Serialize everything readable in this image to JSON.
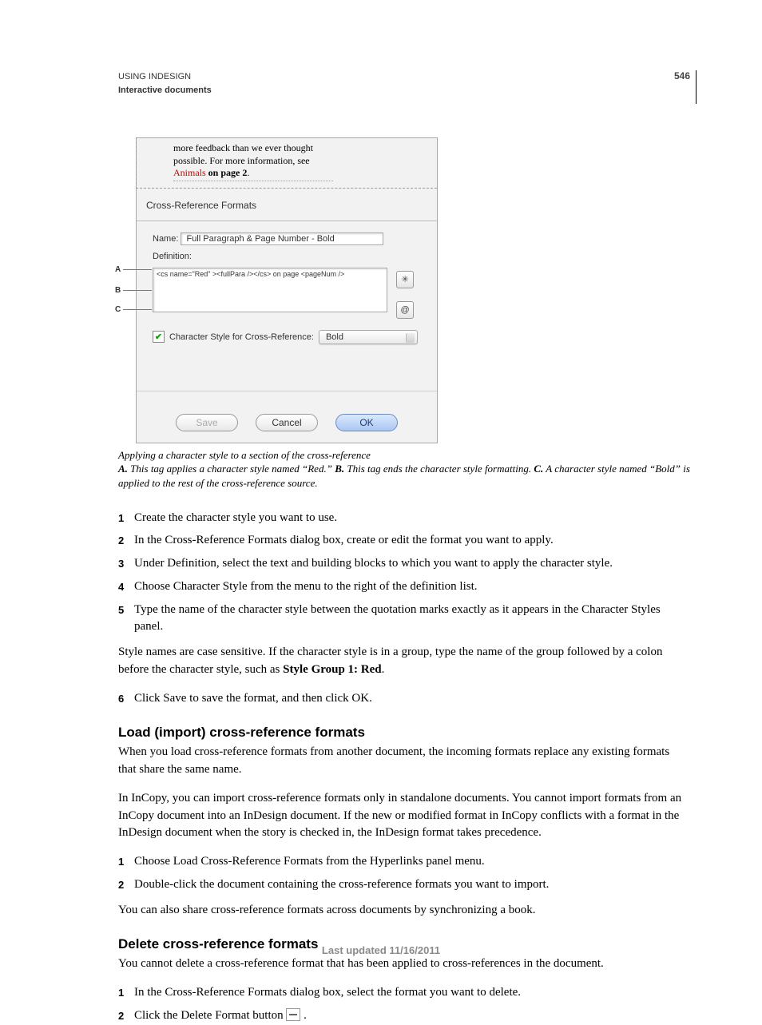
{
  "page_number": "546",
  "running_head": {
    "line1": "USING INDESIGN",
    "line2": "Interactive documents"
  },
  "figure": {
    "doc_line1": "more feedback than we ever thought",
    "doc_line2": "possible. For more information, see",
    "doc_animals": "Animals",
    "doc_onpage": " on page 2",
    "doc_period": ".",
    "panel_title": "Cross-Reference Formats",
    "name_label": "Name:",
    "name_value": "Full Paragraph & Page Number - Bold",
    "definition_label": "Definition:",
    "definition_text": "<cs name=\"Red\" ><fullPara /></cs> on page <pageNum />",
    "checkbox_label": "Character Style for Cross-Reference:",
    "select_value": "Bold",
    "btn_save": "Save",
    "btn_cancel": "Cancel",
    "btn_ok": "OK",
    "annotations": {
      "a": "A",
      "b": "B",
      "c": "C"
    }
  },
  "caption": {
    "title": "Applying a character style to a section of the cross-reference",
    "a_label": "A.",
    "a_text": " This tag applies a character style named “Red.”  ",
    "b_label": "B.",
    "b_text": " This tag ends the character style formatting.  ",
    "c_label": "C.",
    "c_text": " A character style named “Bold” is applied to the rest of the cross-reference source."
  },
  "steps1": [
    "Create the character style you want to use.",
    "In the Cross-Reference Formats dialog box, create or edit the format you want to apply.",
    "Under Definition, select the text and building blocks to which you want to apply the character style.",
    "Choose Character Style from the menu to the right of the definition list.",
    "Type the name of the character style between the quotation marks exactly as it appears in the Character Styles panel."
  ],
  "style_note_pre": "Style names are case sensitive. If the character style is in a group, type the name of the group followed by a colon before the character style, such as ",
  "style_note_bold": "Style Group 1: Red",
  "style_note_post": ".",
  "steps1b": [
    "Click Save to save the format, and then click OK."
  ],
  "h2_load": "Load (import) cross-reference formats",
  "load_p1": "When you load cross-reference formats from another document, the incoming formats replace any existing formats that share the same name.",
  "load_p2": "In InCopy, you can import cross-reference formats only in standalone documents. You cannot import formats from an InCopy document into an InDesign document. If the new or modified format in InCopy conflicts with a format in the InDesign document when the story is checked in, the InDesign format takes precedence.",
  "steps_load": [
    "Choose Load Cross-Reference Formats from the Hyperlinks panel menu.",
    "Double-click the document containing the cross-reference formats you want to import."
  ],
  "load_p3": "You can also share cross-reference formats across documents by synchronizing a book.",
  "h2_delete": "Delete cross-reference formats",
  "delete_p1": "You cannot delete a cross-reference format that has been applied to cross-references in the document.",
  "steps_delete": [
    "In the Cross-Reference Formats dialog box, select the format you want to delete.",
    "Click the Delete Format button "
  ],
  "delete_tail": ".",
  "footer": "Last updated 11/16/2011"
}
